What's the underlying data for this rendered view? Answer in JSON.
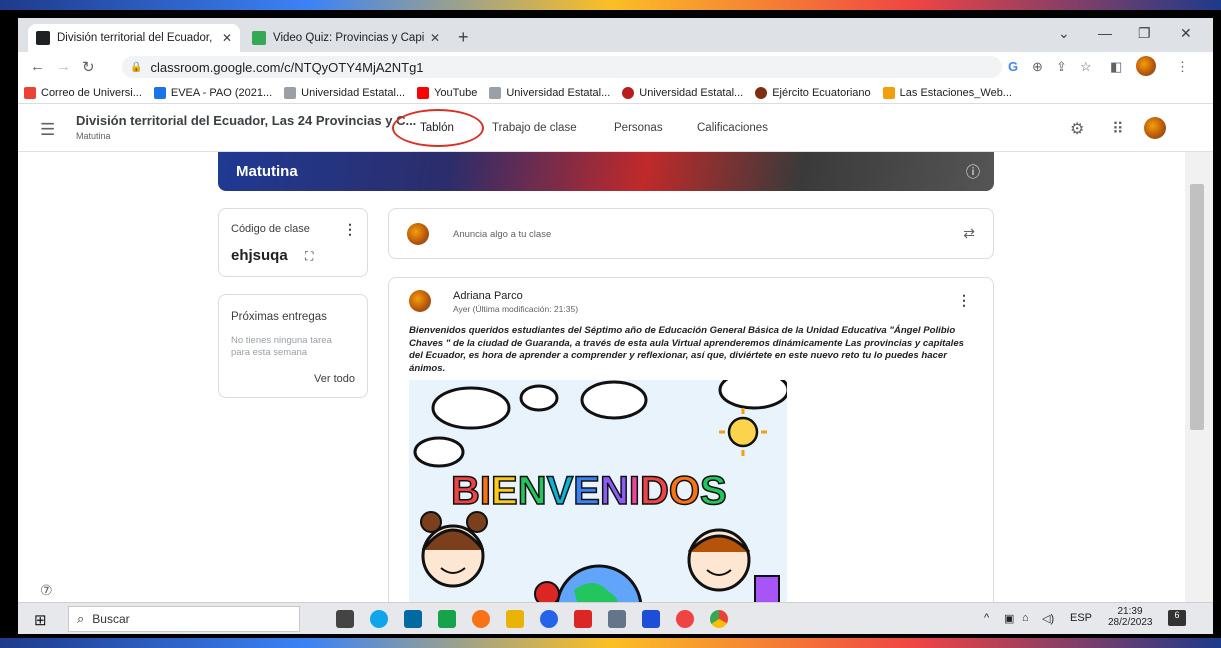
{
  "browser": {
    "tabs": [
      {
        "title": "División territorial del Ecuador, Li",
        "active": true
      },
      {
        "title": "Video Quiz: Provincias y Capitale",
        "active": false
      }
    ],
    "url": "classroom.google.com/c/NTQyOTY4MjA2NTg1",
    "bookmarks": [
      "Correo de Universi...",
      "EVEA - PAO (2021...",
      "Universidad Estatal...",
      "YouTube",
      "Universidad Estatal...",
      "Universidad Estatal...",
      "Ejército Ecuatoriano",
      "Las Estaciones_Web..."
    ]
  },
  "classroom": {
    "class_title": "División territorial del Ecuador, Las 24 Provincias y C...",
    "section": "Matutina",
    "tabs": [
      "Tablón",
      "Trabajo de clase",
      "Personas",
      "Calificaciones"
    ],
    "active_tab": "Tablón",
    "banner_name": "Matutina",
    "class_code_label": "Código de clase",
    "class_code": "ehjsuqa",
    "upcoming_title": "Próximas entregas",
    "upcoming_text": "No tienes ninguna tarea para esta semana",
    "see_all": "Ver todo",
    "announce_placeholder": "Anuncia algo a tu clase",
    "post": {
      "author": "Adriana Parco",
      "time": "Ayer (Última modificación: 21:35)",
      "text": "Bienvenidos queridos estudiantes del Séptimo año de Educación General Básica de la Unidad Educativa \"Ángel Polibio Chaves \" de la ciudad de Guaranda, a través de esta aula Virtual aprenderemos dinámicamente  Las provincias y capitales del Ecuador, es hora de aprender a comprender y reflexionar, así que, diviértete en este nuevo reto tu lo puedes hacer ánimos.",
      "image_text": "BIENVENIDOS"
    }
  },
  "taskbar": {
    "search_placeholder": "Buscar",
    "lang": "ESP",
    "time": "21:39",
    "date": "28/2/2023",
    "notifications": "6"
  },
  "colors": {
    "highlight_ring": "#d93025",
    "accent": "#1a73e8"
  }
}
